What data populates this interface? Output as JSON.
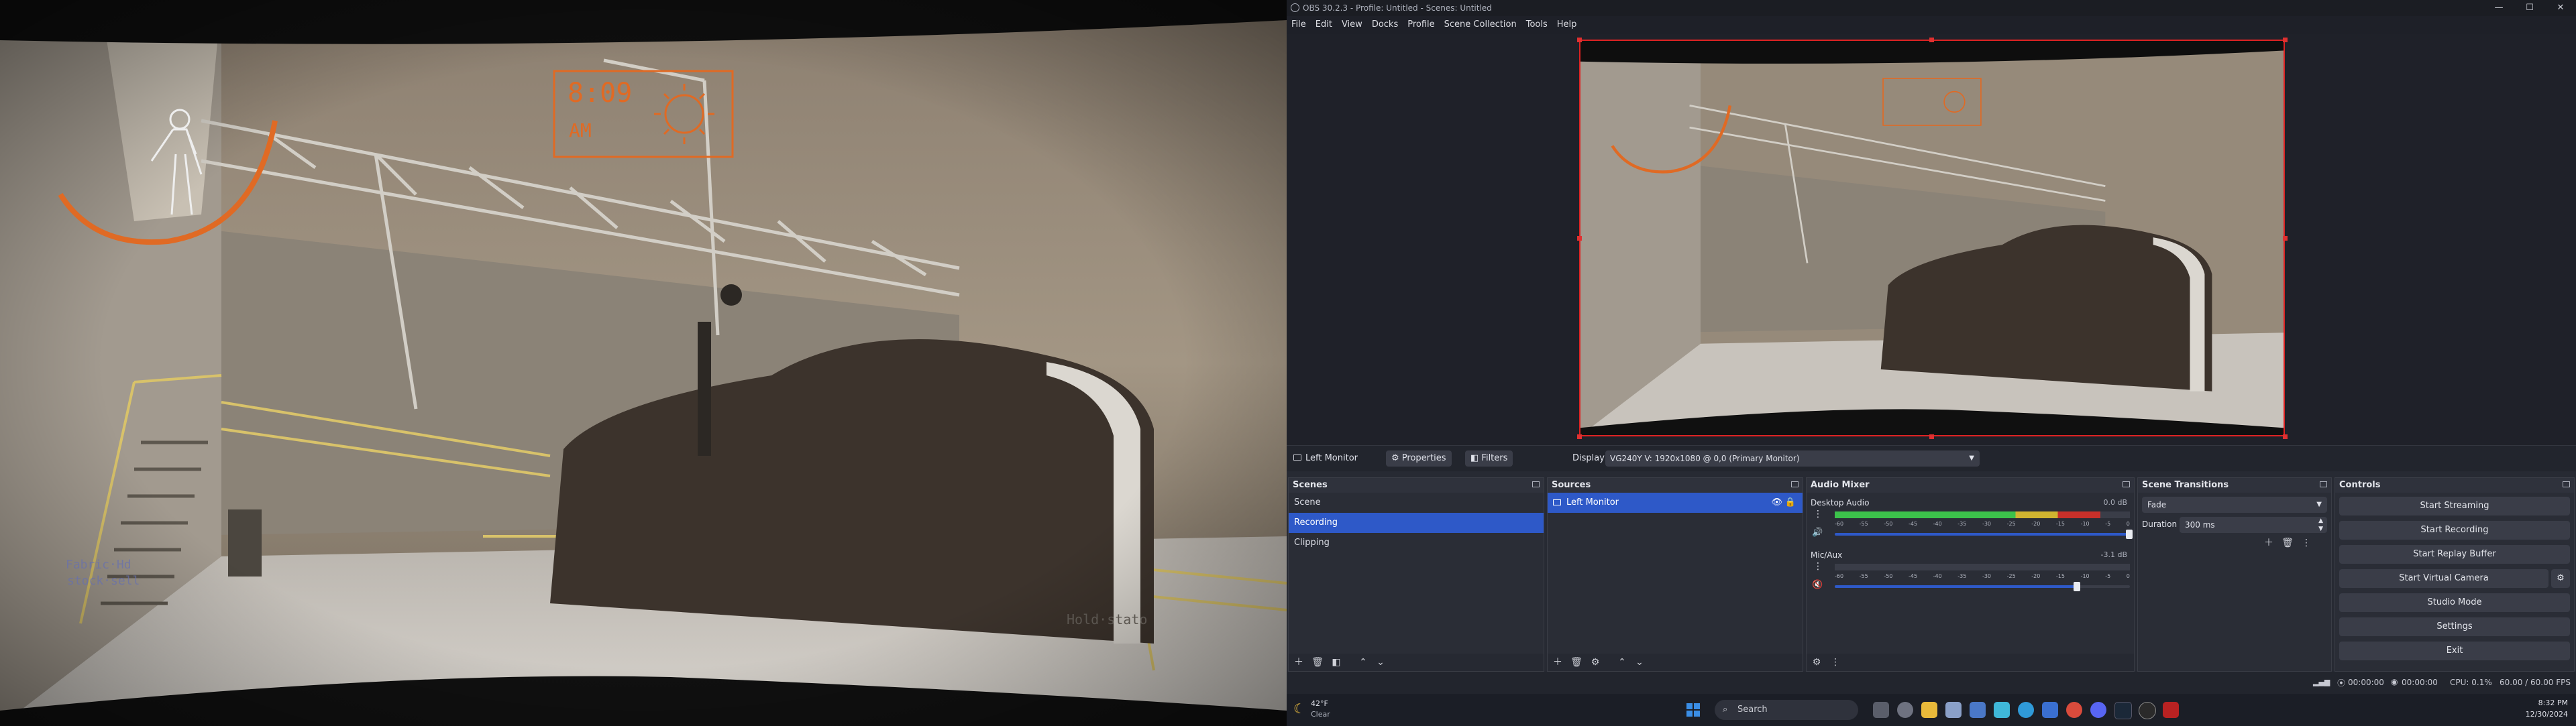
{
  "game": {
    "clock_time": "8:09",
    "clock_period": "AM",
    "weather_icon": "sun-icon",
    "hud_icon": "player-silhouette-icon",
    "wall_sign": "Hold·stato",
    "left_sign": "Fabric·Hd",
    "left_sign2": "stock·sell"
  },
  "window": {
    "title": "OBS 30.2.3 - Profile: Untitled - Scenes: Untitled",
    "minimize": "—",
    "maximize": "☐",
    "close": "✕"
  },
  "menu": [
    "File",
    "Edit",
    "View",
    "Docks",
    "Profile",
    "Scene Collection",
    "Tools",
    "Help"
  ],
  "source_bar": {
    "source_name": "Left Monitor",
    "properties": "Properties",
    "filters": "Filters",
    "display_label": "Display",
    "display_value": "VG240Y V: 1920x1080 @ 0,0 (Primary Monitor)"
  },
  "scenes": {
    "title": "Scenes",
    "items": [
      "Scene",
      "Recording",
      "Clipping"
    ],
    "selected": "Recording"
  },
  "sources": {
    "title": "Sources",
    "items": [
      "Left Monitor"
    ]
  },
  "mixer": {
    "title": "Audio Mixer",
    "channels": [
      {
        "name": "Desktop Audio",
        "db": "0.0 dB",
        "level": 0.9,
        "volume": 1.0
      },
      {
        "name": "Mic/Aux",
        "db": "-3.1 dB",
        "level": 0.0,
        "volume": 0.82
      }
    ],
    "scale": [
      "-60",
      "-55",
      "-50",
      "-45",
      "-40",
      "-35",
      "-30",
      "-25",
      "-20",
      "-15",
      "-10",
      "-5",
      "0"
    ]
  },
  "transitions": {
    "title": "Scene Transitions",
    "value": "Fade",
    "duration_label": "Duration",
    "duration_value": "300 ms"
  },
  "controls": {
    "title": "Controls",
    "buttons": [
      "Start Streaming",
      "Start Recording",
      "Start Replay Buffer",
      "Start Virtual Camera",
      "Studio Mode",
      "Settings",
      "Exit"
    ]
  },
  "status": {
    "stream_time": "00:00:00",
    "rec_time": "00:00:00",
    "cpu": "CPU: 0.1%",
    "fps": "60.00 / 60.00 FPS"
  },
  "taskbar": {
    "weather_temp": "42°F",
    "weather_cond": "Clear",
    "search_placeholder": "Search",
    "time": "8:32 PM",
    "date": "12/30/2024"
  },
  "colors": {
    "accent": "#2e59c8",
    "selection_red": "#e03030",
    "hud_orange": "#e06a24",
    "meter_green": "#3cc24b",
    "meter_yellow": "#d0b430",
    "meter_red": "#c8302a"
  }
}
